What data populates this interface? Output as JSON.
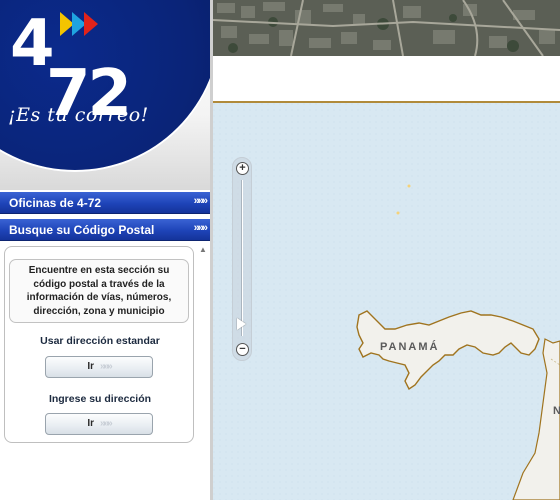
{
  "brand": {
    "logo_top": "4",
    "logo_bottom": "72",
    "slogan": "¡Es tu correo!"
  },
  "nav": {
    "oficinas_label": "Oficinas de 4-72",
    "busque_label": "Busque su Código Postal",
    "arrow_glyph": "»»»"
  },
  "search": {
    "intro": "Encuentre en esta sección su código postal a través de la información de vías, números, dirección, zona y municipio",
    "standard_label": "Usar dirección estandar",
    "standard_button": "Ir",
    "custom_label": "Ingrese su dirección",
    "custom_button": "Ir",
    "button_arrow": "»»»"
  },
  "map": {
    "country_label": "PANAMÁ",
    "edge_label": "N",
    "zoom_in": "+",
    "zoom_out": "−",
    "zoom_level_fraction": 0.08,
    "colors": {
      "sea": "#d8e8f2",
      "land": "#f2f1ec",
      "border": "#a0741f"
    }
  },
  "colors": {
    "brand_blue": "#0a2478",
    "nav_blue": "#1e44b8"
  },
  "icons": [
    "chevron-right-icon",
    "zoom-in-icon",
    "zoom-out-icon",
    "scroll-up-arrow-icon"
  ]
}
